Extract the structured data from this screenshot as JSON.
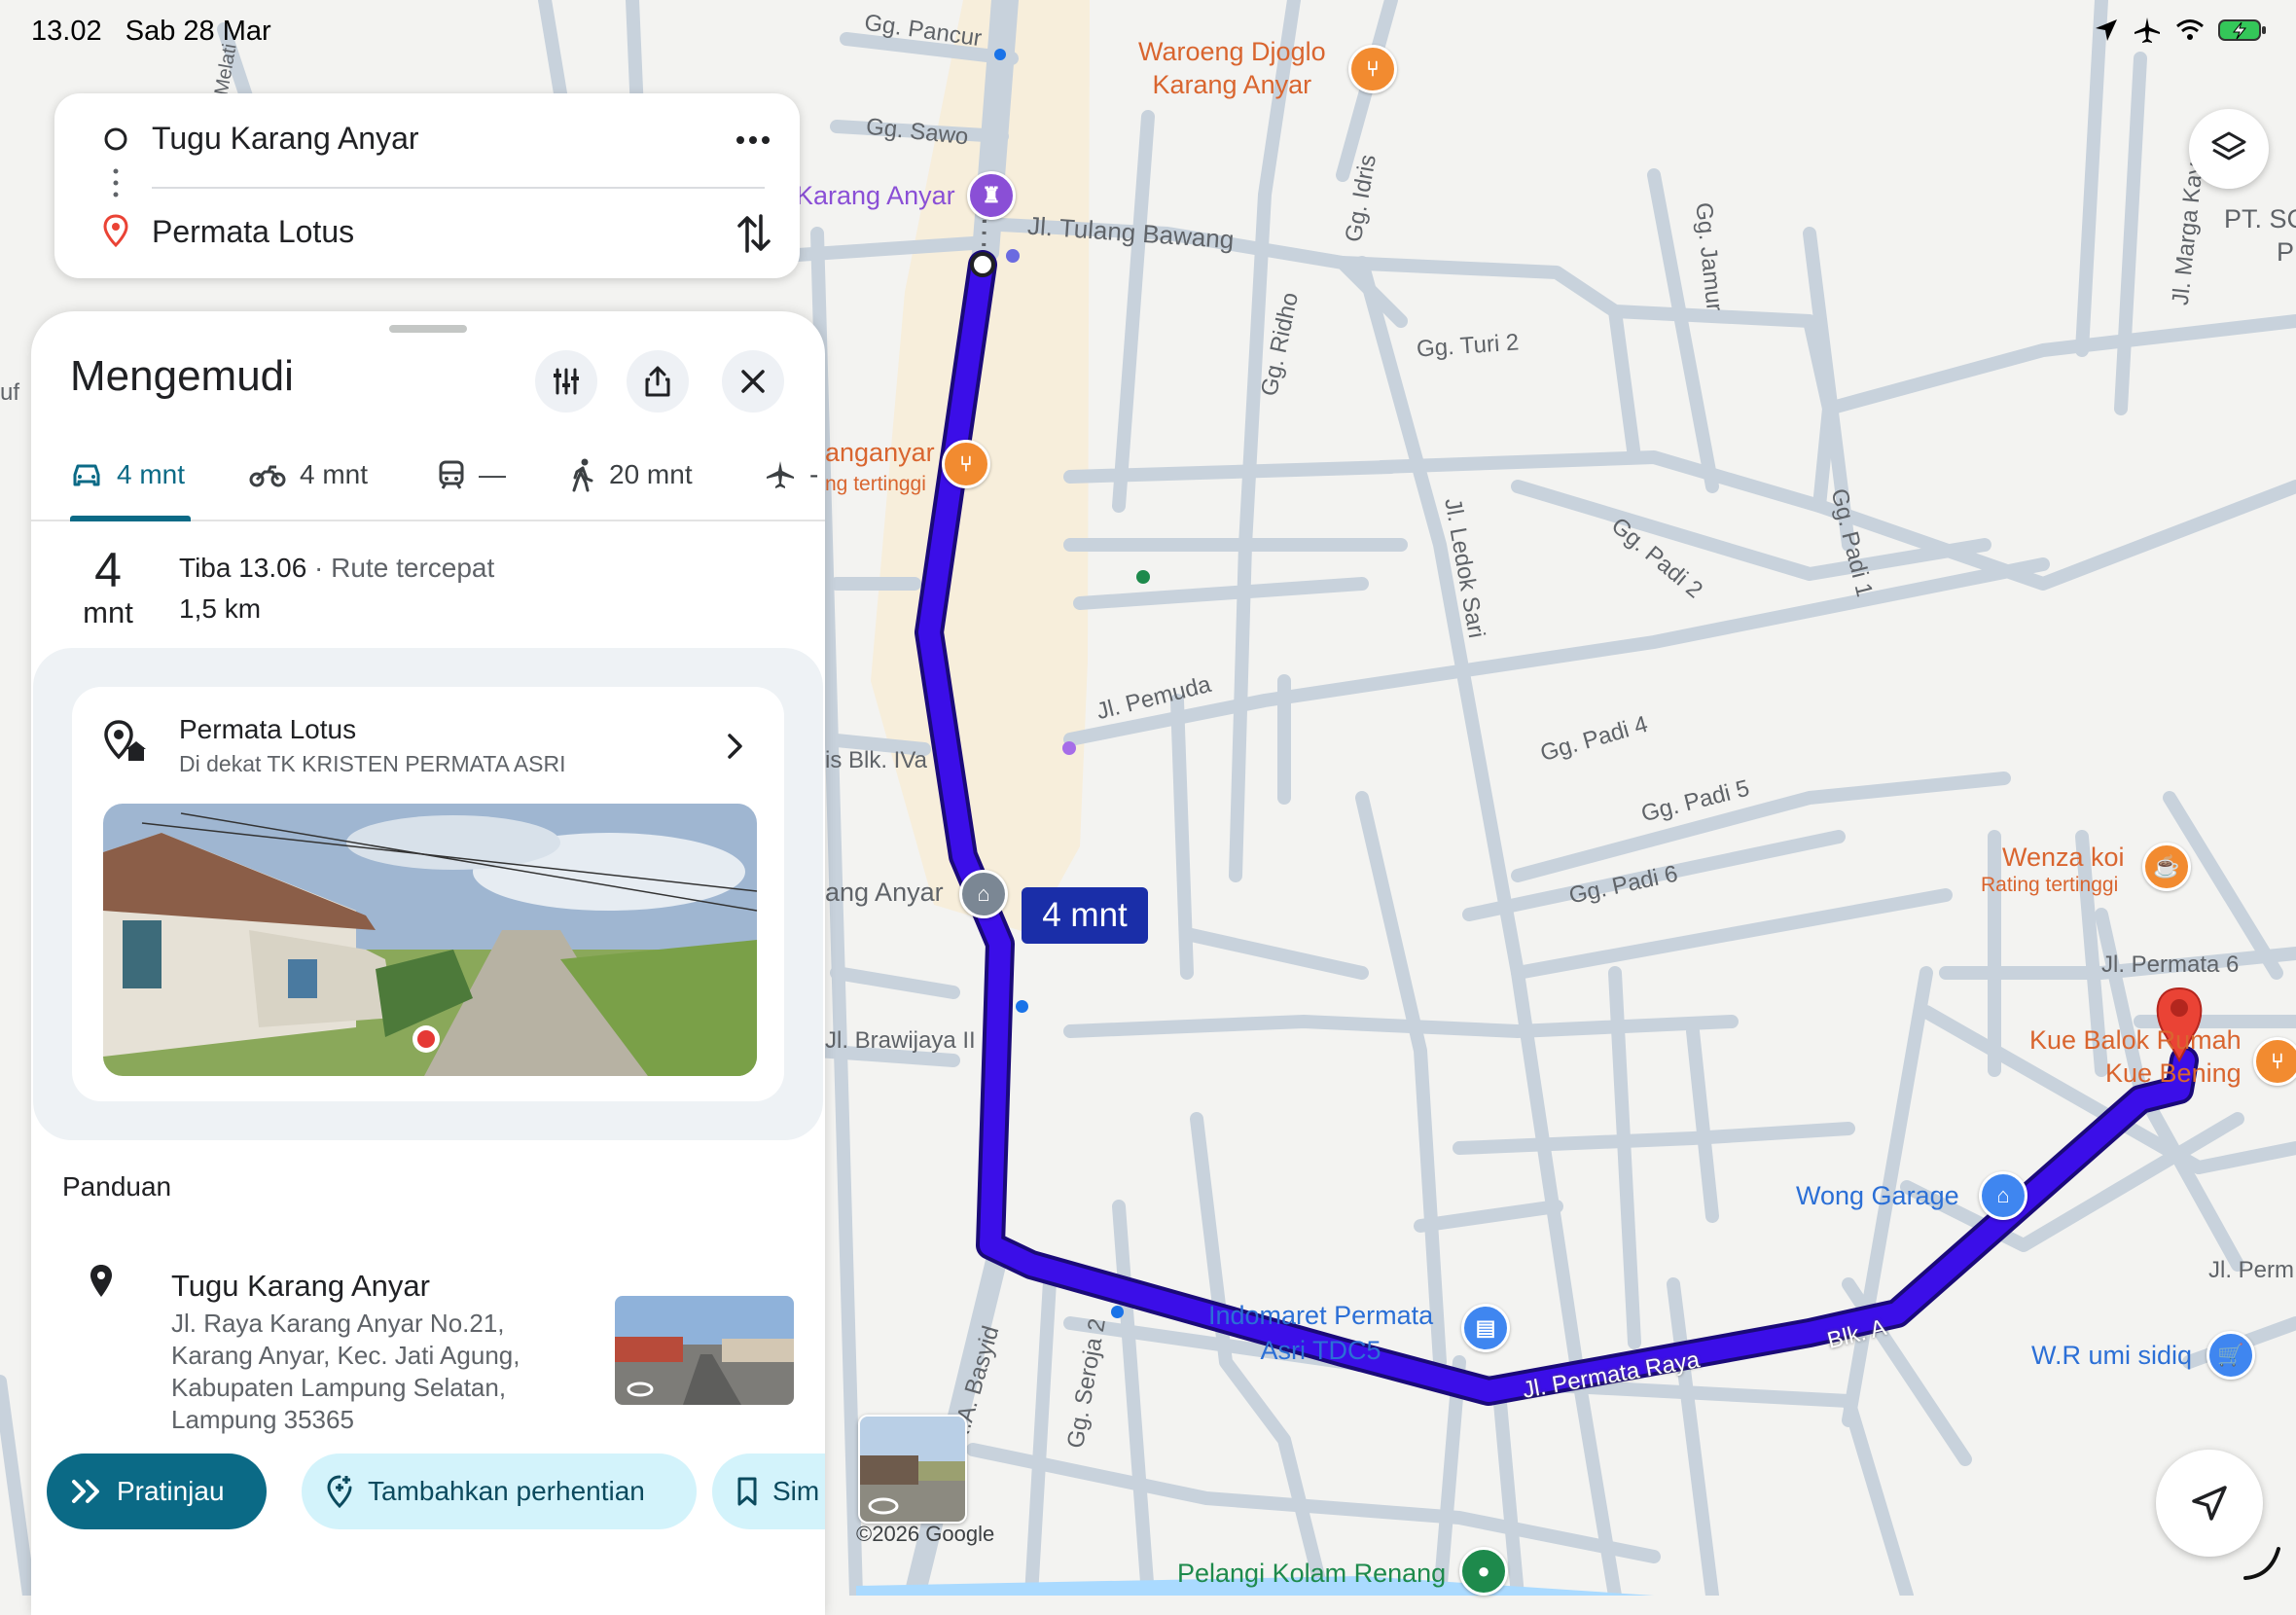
{
  "status_bar": {
    "time": "13.02",
    "date": "Sab 28 Mar"
  },
  "route": {
    "origin": "Tugu Karang Anyar",
    "destination": "Permata Lotus"
  },
  "panel": {
    "title": "Mengemudi",
    "tabs": [
      {
        "mode": "car-icon",
        "label": "4 mnt",
        "active": true
      },
      {
        "mode": "motorcycle-icon",
        "label": "4 mnt"
      },
      {
        "mode": "transit-icon",
        "label": "—"
      },
      {
        "mode": "walk-icon",
        "label": "20 mnt"
      },
      {
        "mode": "flight-icon",
        "label": "-"
      }
    ],
    "summary": {
      "duration_number": "4",
      "duration_unit": "mnt",
      "arrival": "Tiba 13.06",
      "separator": " · ",
      "route_note": "Rute tercepat",
      "distance": "1,5 km"
    },
    "destination_card": {
      "name": "Permata Lotus",
      "subtitle": "Di dekat TK KRISTEN PERMATA ASRI"
    },
    "guide_heading": "Panduan",
    "step": {
      "title": "Tugu Karang Anyar",
      "address": "Jl. Raya Karang Anyar No.21, Karang Anyar, Kec. Jati Agung, Kabupaten Lampung Selatan, Lampung 35365"
    },
    "chips": {
      "preview": "Pratinjau",
      "add_stop": "Tambahkan perhentian",
      "save": "Sim"
    }
  },
  "map": {
    "eta": "4 mnt",
    "copyright": "©2026 Google",
    "streets": {
      "pancur": "Gg. Pancur",
      "sawo": "Gg. Sawo",
      "tulang_bawang": "Jl. Tulang Bawang",
      "idris": "Gg. Idris",
      "ridho": "Gg. Ridho",
      "jamur": "Gg. Jamur",
      "turi": "Gg. Turi 2",
      "marga": "Jl. Marga Kaya",
      "ledok": "Jl. Ledok Sari",
      "padi2": "Gg. Padi 2",
      "padi1": "Gg. Padi 1",
      "pemuda": "Jl. Pemuda",
      "padi4": "Gg. Padi 4",
      "padi5": "Gg. Padi 5",
      "padi6": "Gg. Padi 6",
      "permata6": "Jl. Permata 6",
      "brawijaya": "Jl. Brawijaya II",
      "blk4": "is Blk. IVa",
      "basyid": "R.A. Basyid",
      "seroja": "Gg. Seroja 2",
      "permata_raya": "Jl. Permata Raya",
      "blka": "Blk. A",
      "jl_perm": "Jl. Perm",
      "melati": "Melati",
      "uf": "uf",
      "pt": "PT. SC",
      "pt2": "P"
    },
    "pois": {
      "waroeng": "Waroeng Djoglo\nKarang Anyar",
      "karang_anyar_1": "Karang Anyar",
      "karanganyar_food": "anganyar",
      "karanganyar_food_sub": "ng tertinggi",
      "karang_anyar_2": "ang Anyar",
      "wenza": "Wenza koi",
      "wenza_sub": "Rating tertinggi",
      "kue_balok": "Kue Balok Rumah\nKue Bening",
      "wong_garage": "Wong Garage",
      "indomaret": "Indomaret Permata\nAsri TDC5",
      "wr_umi": "W.R umi sidiq",
      "pelangi": "Pelangi Kolam Renang"
    },
    "colors": {
      "route": "#3b0ee8",
      "route_outline": "#1a0a78",
      "teal": "#0b6a86"
    }
  }
}
